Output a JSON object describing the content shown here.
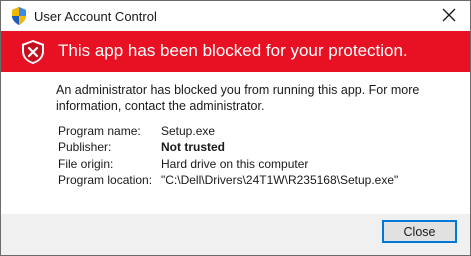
{
  "window": {
    "title": "User Account Control"
  },
  "banner": {
    "message": "This app has been blocked for your protection.",
    "color": "#e81123"
  },
  "body": {
    "message_line1": "An administrator has blocked you from running this app. For more",
    "message_line2": "information, contact the administrator."
  },
  "details": {
    "program_name_label": "Program name:",
    "program_name_value": "Setup.exe",
    "publisher_label": "Publisher:",
    "publisher_value": "Not trusted",
    "file_origin_label": "File origin:",
    "file_origin_value": "Hard drive on this computer",
    "program_location_label": "Program location:",
    "program_location_value": "\"C:\\Dell\\Drivers\\24T1W\\R235168\\Setup.exe\""
  },
  "footer": {
    "close_label": "Close",
    "accent": "#0078d7"
  },
  "icons": {
    "title": "uac-shield-icon",
    "close": "close-icon",
    "banner": "blocked-shield-icon"
  }
}
